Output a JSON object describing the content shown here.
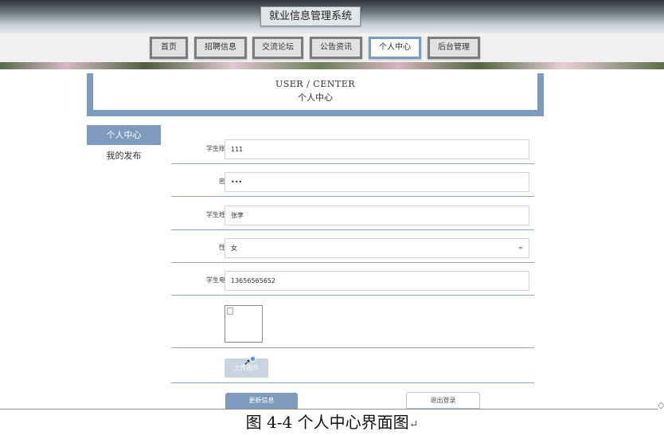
{
  "header": {
    "title": "就业信息管理系统"
  },
  "nav": {
    "items": [
      {
        "label": "首页"
      },
      {
        "label": "招聘信息"
      },
      {
        "label": "交流论坛"
      },
      {
        "label": "公告资讯"
      },
      {
        "label": "个人中心",
        "active": true
      },
      {
        "label": "后台管理"
      }
    ]
  },
  "center": {
    "title_en": "USER / CENTER",
    "title_zh": "个人中心"
  },
  "sidebar": {
    "items": [
      {
        "label": "个人中心"
      },
      {
        "label": "我的发布"
      }
    ]
  },
  "form": {
    "account": {
      "label": "学生账号",
      "value": "111"
    },
    "password": {
      "label": "密码",
      "value": "•••"
    },
    "name": {
      "label": "学生姓名",
      "value": "张李"
    },
    "gender": {
      "label": "性别",
      "value": "女"
    },
    "phone": {
      "label": "学生电话",
      "value": "13656565652"
    },
    "upload_label": "上传图片",
    "save_label": "更新信息",
    "logout_label": "退出登录"
  },
  "caption": {
    "text": "图 4-4 个人中心界面图",
    "return_mark": "↵"
  },
  "colors": {
    "accent": "#7e9bbd",
    "nav_border": "#7d7d7d"
  }
}
